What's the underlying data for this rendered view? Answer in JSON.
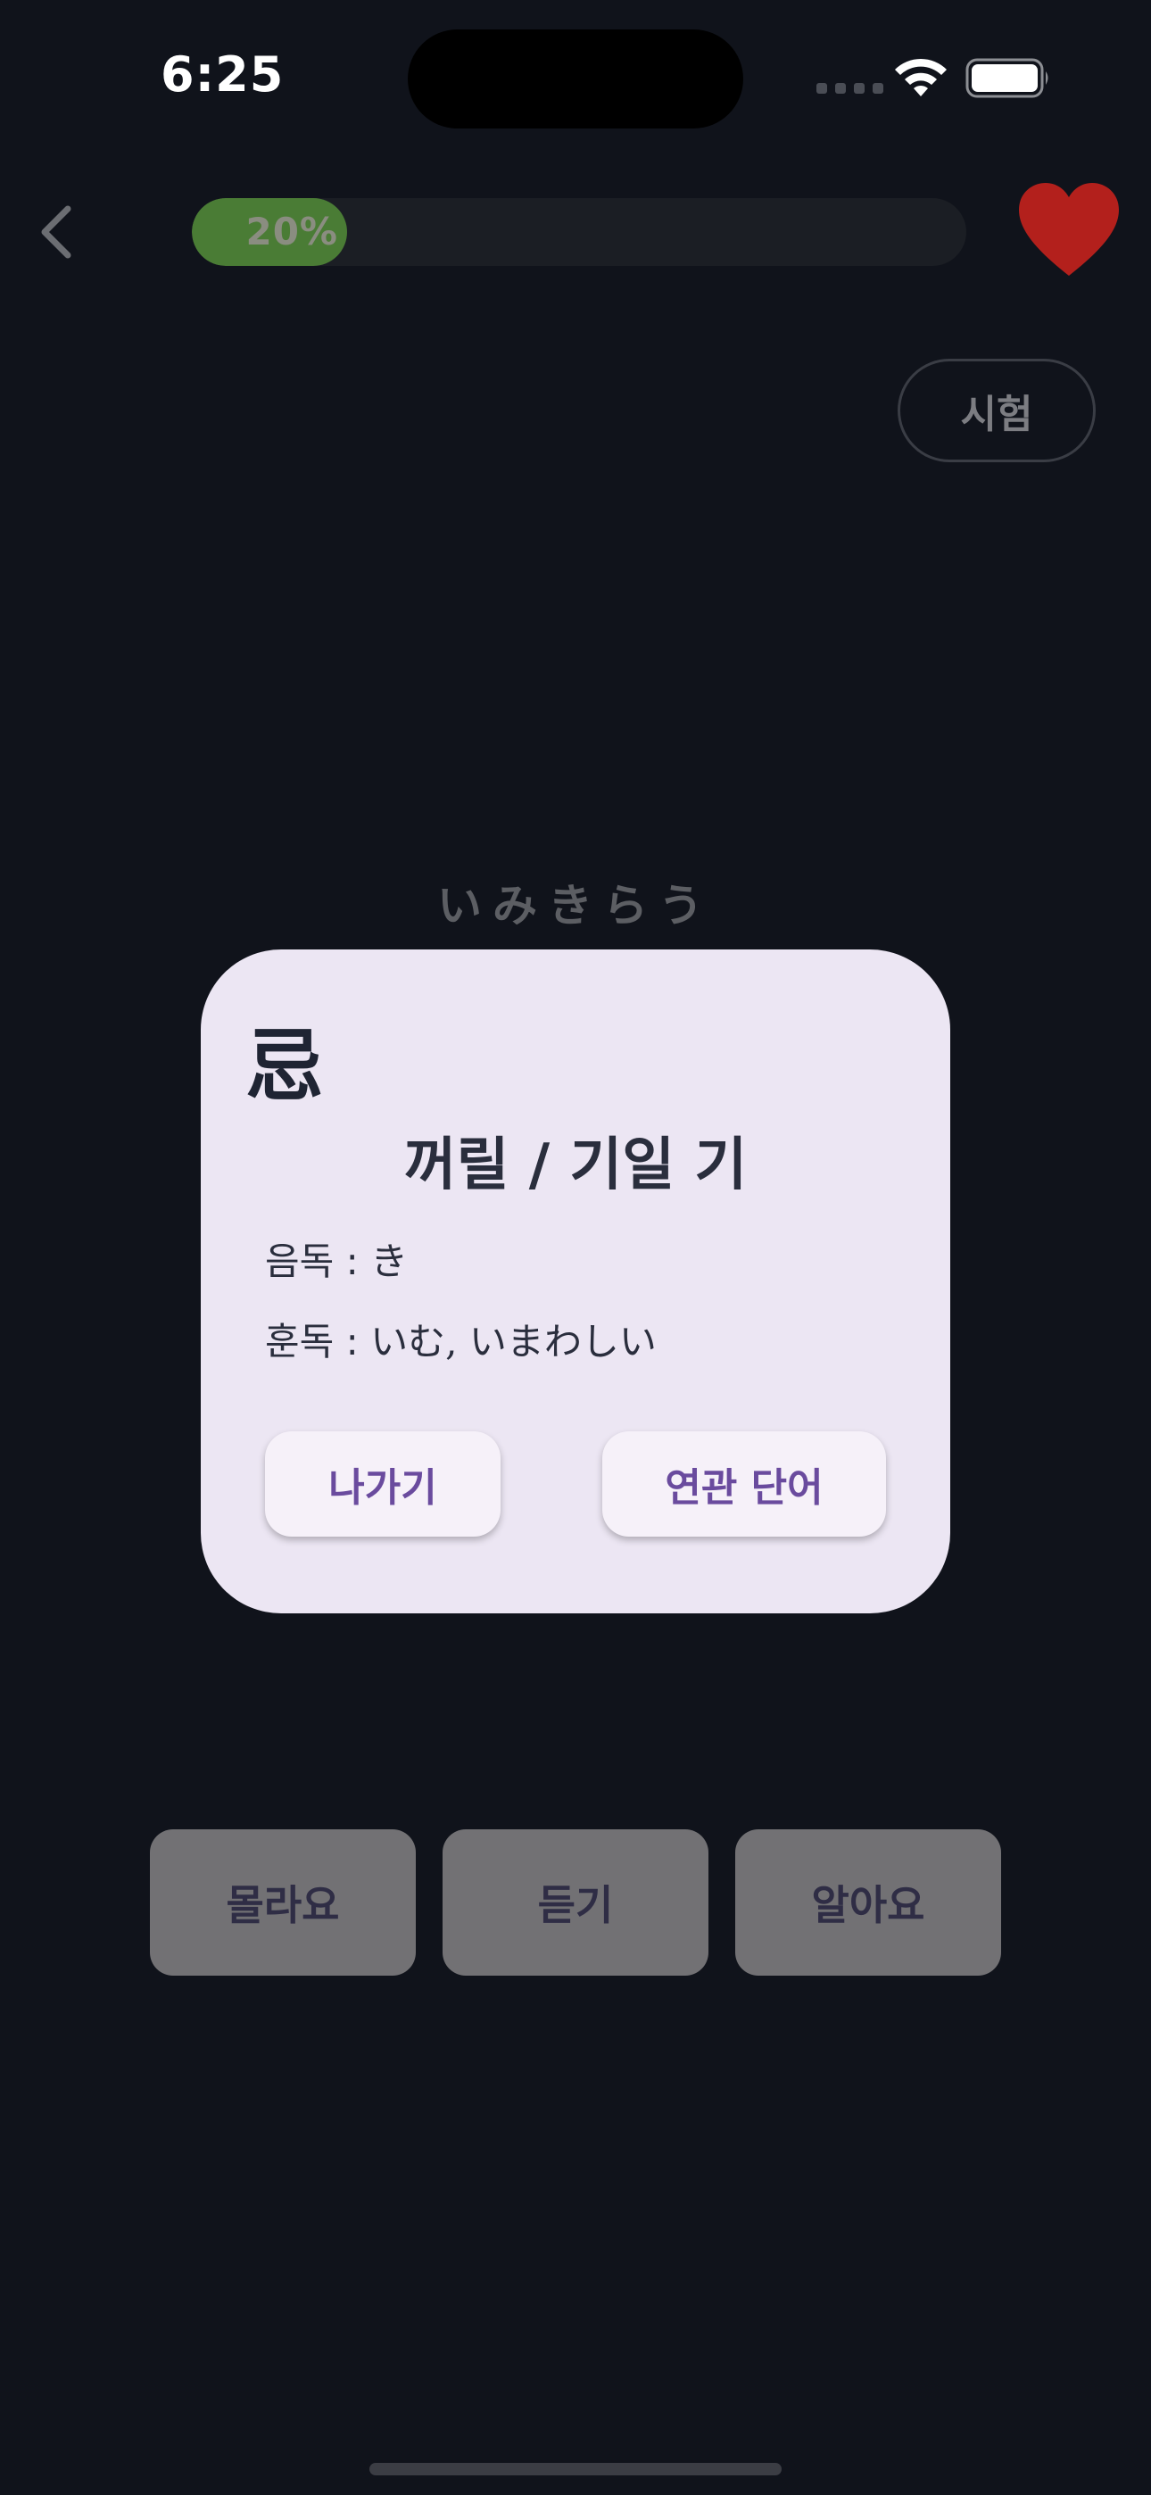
{
  "status_bar": {
    "time": "6:25"
  },
  "header": {
    "progress": {
      "percent": 20,
      "label": "20%"
    },
    "test_button_label": "시험"
  },
  "card": {
    "reading": "いみきらう"
  },
  "bottom_actions": {
    "dont_know": "몰라요",
    "listen": "듣기",
    "know": "알아요"
  },
  "modal": {
    "kanji": "忌",
    "meaning": "꺼릴 / 기일 기",
    "onyomi_label": "음독 :",
    "onyomi_value": "き",
    "kunyomi_label": "훈독 :",
    "kunyomi_value": "いむ, いまわしい",
    "exit_label": "나가기",
    "related_label": "연관 단어"
  },
  "colors": {
    "background": "#10131b",
    "progress_fill": "#4a7c35",
    "heart": "#b3201c",
    "modal_bg": "#ece6f3",
    "accent": "#6a4b9e"
  },
  "icons": {
    "back": "chevron-left-icon",
    "favorite": "heart-icon",
    "wifi": "wifi-icon",
    "battery": "battery-icon"
  }
}
